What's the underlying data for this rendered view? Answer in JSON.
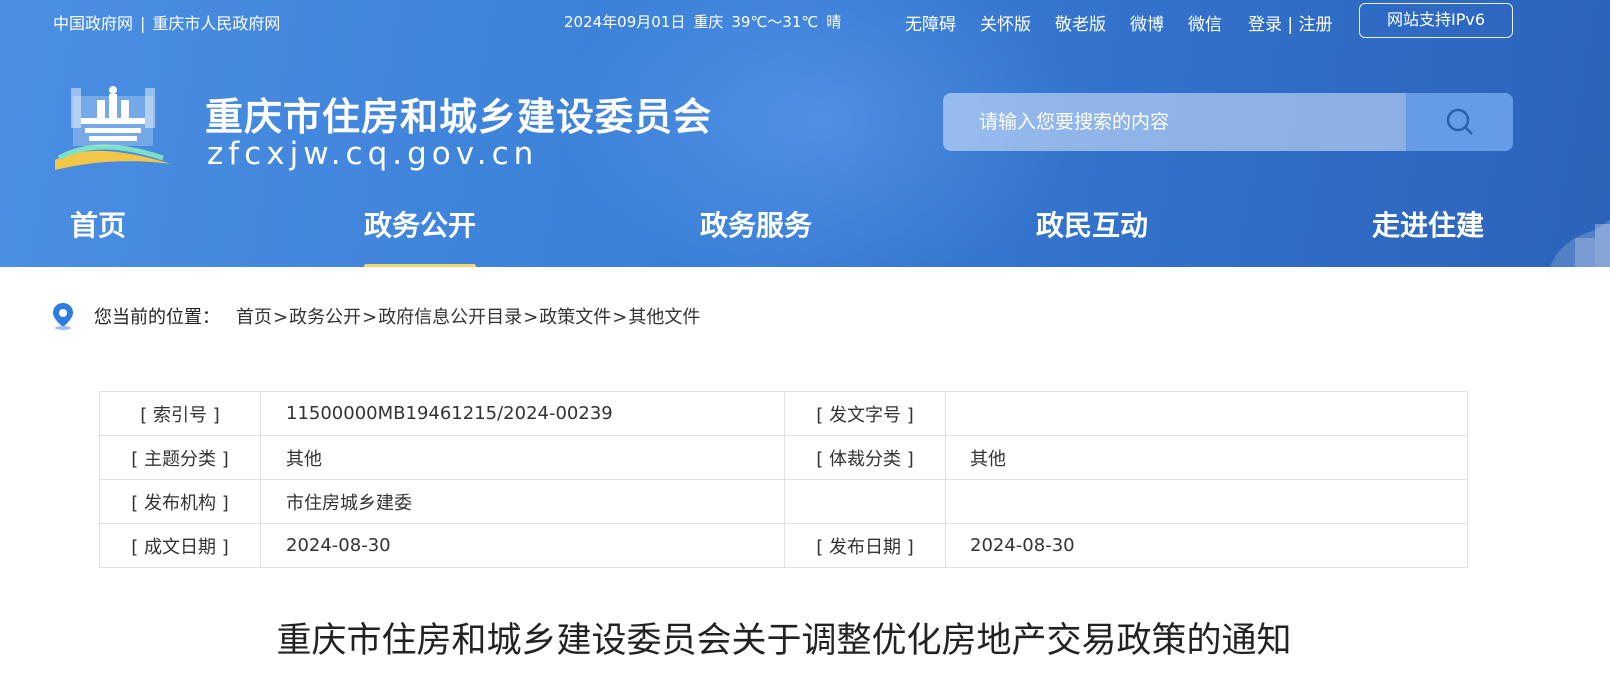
{
  "topbar": {
    "left_links": [
      "中国政府网",
      "重庆市人民政府网"
    ],
    "left_sep": "|",
    "date": "2024年09月01日",
    "city": "重庆",
    "temperature": "39℃～31℃",
    "weather": "晴",
    "quick_links": [
      "无障碍",
      "关怀版",
      "敬老版",
      "微博",
      "微信"
    ],
    "login": "登录",
    "login_sep": "|",
    "register": "注册",
    "ipv6": "网站支持IPv6"
  },
  "site": {
    "title": "重庆市住房和城乡建设委员会",
    "domain": "zfcxjw.cq.gov.cn"
  },
  "search": {
    "placeholder": "请输入您要搜索的内容",
    "icon": "search-icon"
  },
  "nav": {
    "items": [
      {
        "label": "首页",
        "active": false
      },
      {
        "label": "政务公开",
        "active": true
      },
      {
        "label": "政务服务",
        "active": false
      },
      {
        "label": "政民互动",
        "active": false
      },
      {
        "label": "走进住建",
        "active": false
      }
    ]
  },
  "breadcrumb": {
    "icon": "location-pin-icon",
    "label": "您当前的位置：",
    "items": [
      "首页",
      "政务公开",
      "政府信息公开目录",
      "政策文件",
      "其他文件"
    ],
    "sep": ">"
  },
  "meta": {
    "rows": [
      {
        "k1": "[ 索引号 ]",
        "v1": "11500000MB19461215/2024-00239",
        "k2": "[ 发文字号 ]",
        "v2": ""
      },
      {
        "k1": "[ 主题分类 ]",
        "v1": "其他",
        "k2": "[ 体裁分类 ]",
        "v2": "其他"
      },
      {
        "k1": "[ 发布机构 ]",
        "v1": "市住房城乡建委",
        "k2": "",
        "v2": ""
      },
      {
        "k1": "[ 成文日期 ]",
        "v1": "2024-08-30",
        "k2": "[ 发布日期 ]",
        "v2": "2024-08-30"
      }
    ]
  },
  "document": {
    "title": "重庆市住房和城乡建设委员会关于调整优化房地产交易政策的通知"
  },
  "colors": {
    "header_blue": "#3a7fd8",
    "nav_underline": "#f6d56a",
    "pin_blue": "#2f7de1"
  }
}
